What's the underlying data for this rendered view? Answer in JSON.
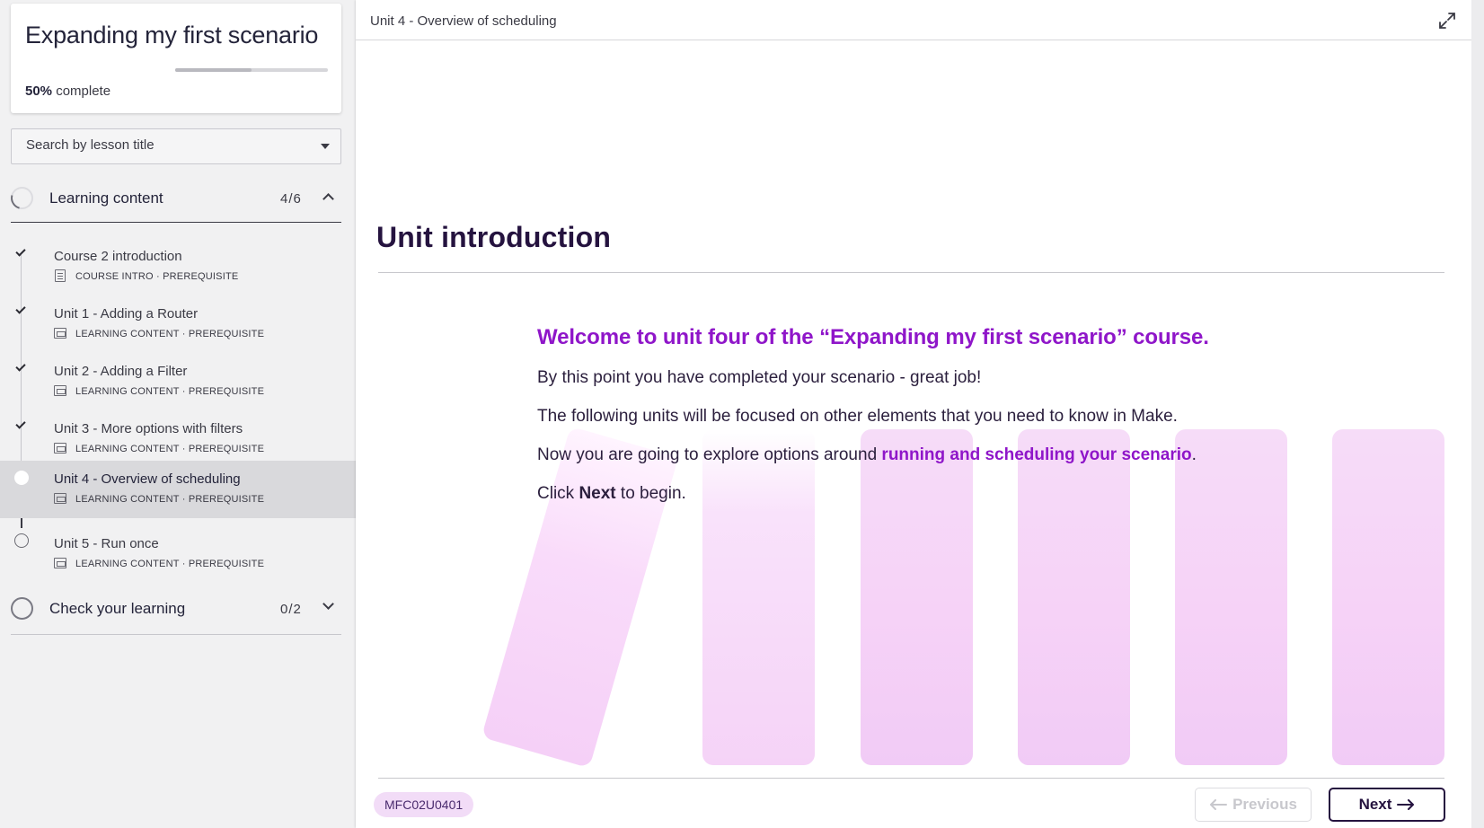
{
  "course": {
    "title": "Expanding my first scenario",
    "progress_percent": 50,
    "progress_value": "50%",
    "progress_suffix": " complete"
  },
  "search": {
    "placeholder": "Search by lesson title"
  },
  "sections": [
    {
      "title": "Learning content",
      "count": "4/6",
      "expanded": true,
      "lessons": [
        {
          "title": "Course 2 introduction",
          "meta": "COURSE INTRO · PREREQUISITE",
          "status": "complete",
          "icon": "document-icon"
        },
        {
          "title": "Unit 1 - Adding a Router",
          "meta": "LEARNING CONTENT · PREREQUISITE",
          "status": "complete",
          "icon": "slides-icon"
        },
        {
          "title": "Unit 2 - Adding a Filter",
          "meta": "LEARNING CONTENT · PREREQUISITE",
          "status": "complete",
          "icon": "slides-icon"
        },
        {
          "title": "Unit 3 - More options with filters",
          "meta": "LEARNING CONTENT · PREREQUISITE",
          "status": "complete",
          "icon": "slides-icon"
        },
        {
          "title": "Unit 4 - Overview of scheduling",
          "meta": "LEARNING CONTENT · PREREQUISITE",
          "status": "current",
          "icon": "slides-icon"
        },
        {
          "title": "Unit 5 - Run once",
          "meta": "LEARNING CONTENT · PREREQUISITE",
          "status": "not-started",
          "icon": "slides-icon"
        }
      ]
    },
    {
      "title": "Check your learning",
      "count": "0/2",
      "expanded": false,
      "lessons": []
    }
  ],
  "topbar": {
    "breadcrumb": "Unit 4 - Overview of scheduling",
    "expand_icon": "expand-icon"
  },
  "content": {
    "heading": "Unit introduction",
    "intro_headline": "Welcome to unit four of the “Expanding my first scenario” course.",
    "para1": "By this point you have completed your scenario - great job!",
    "para2": "The following units will be focused on other elements that you need to know in Make.",
    "para3_pre": "Now you are going to explore options around ",
    "para3_link": "running and scheduling your scenario",
    "para3_post": ".",
    "para4_pre": "Click ",
    "para4_bold": "Next",
    "para4_post": " to begin."
  },
  "footer": {
    "code": "MFC02U0401",
    "previous_label": "Previous",
    "next_label": "Next",
    "previous_enabled": false
  },
  "colors": {
    "accent_purple": "#8f16c9",
    "heading_dark": "#25133f",
    "decor_pink": "#f6d2f7",
    "active_row": "#d9d9dc"
  }
}
